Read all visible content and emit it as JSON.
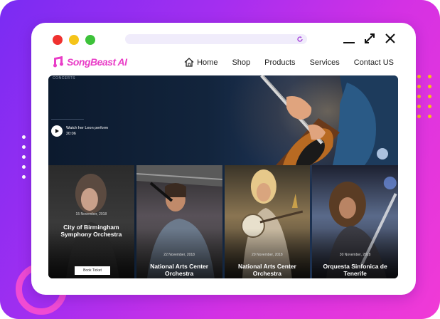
{
  "brand": {
    "logo_text": "SongBeast AI",
    "accent": "#e93ec7"
  },
  "nav": {
    "items": [
      {
        "label": "Home",
        "icon": "home-icon"
      },
      {
        "label": "Shop"
      },
      {
        "label": "Products"
      },
      {
        "label": "Services"
      },
      {
        "label": "Contact US"
      }
    ]
  },
  "hero": {
    "section_label": "CONCERTS",
    "video_title": "Watch her Leon perform",
    "video_duration": "20:06"
  },
  "events": [
    {
      "date": "15 November, 2018",
      "title": "City of Birmingham Symphony Orchestra",
      "button": "Book Ticket"
    },
    {
      "date": "22 November, 2018",
      "title": "National Arts Center Orchestra"
    },
    {
      "date": "29 November, 2018",
      "title": "National Arts Center Orchestra"
    },
    {
      "date": "30 November, 2018",
      "title": "Orquesta Sinfonica de Tenerife"
    }
  ]
}
